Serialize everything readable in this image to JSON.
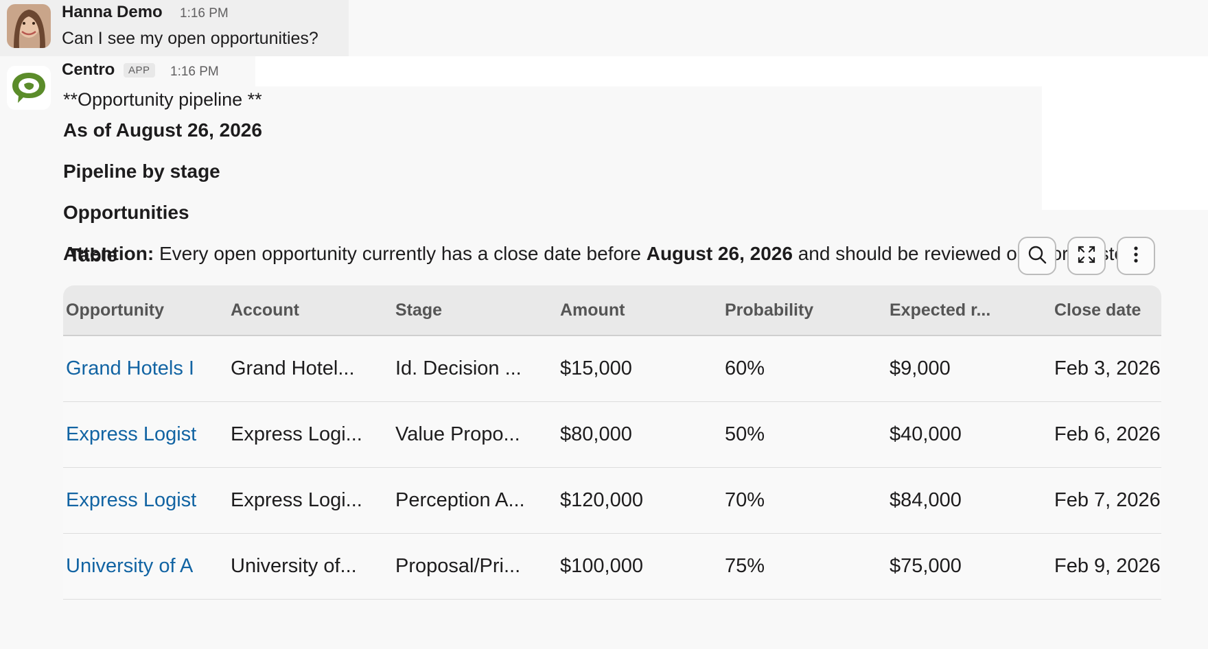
{
  "messages": {
    "user": {
      "name": "Hanna Demo",
      "time": "1:16 PM",
      "text": "Can I see my open opportunities?"
    },
    "bot": {
      "name": "Centro",
      "badge": "APP",
      "time": "1:16 PM",
      "heading_raw": "**Opportunity pipeline **",
      "as_of": "As of August 26, 2026",
      "section_stage": "Pipeline by stage",
      "section_opps": "Opportunities",
      "attention_label": "Attention:",
      "attention_text_1": " Every open opportunity currently has a close date before ",
      "attention_date": "August 26, 2026",
      "attention_text_2": " and should be reviewed or reforecasted."
    }
  },
  "table": {
    "title": "Table",
    "icons": [
      "search-icon",
      "expand-icon",
      "more-vertical-icon"
    ],
    "headers": [
      "Opportunity",
      "Account",
      "Stage",
      "Amount",
      "Probability",
      "Expected r...",
      "Close date"
    ],
    "rows": [
      [
        "Grand Hotels I",
        "Grand Hotel...",
        "Id. Decision ...",
        "$15,000",
        "60%",
        "$9,000",
        "Feb 3, 2026"
      ],
      [
        "Express Logisti",
        "Express Logi...",
        "Value Propo...",
        "$80,000",
        "50%",
        "$40,000",
        "Feb 6, 2026"
      ],
      [
        "Express Logisti",
        "Express Logi...",
        "Perception A...",
        "$120,000",
        "70%",
        "$84,000",
        "Feb 7, 2026"
      ],
      [
        "University of A",
        "University of...",
        "Proposal/Pri...",
        "$100,000",
        "75%",
        "$75,000",
        "Feb 9, 2026"
      ]
    ]
  },
  "colors": {
    "link": "#1264a3",
    "bot_logo": "#5b8c2a",
    "header_bg": "#e9e9e9"
  }
}
